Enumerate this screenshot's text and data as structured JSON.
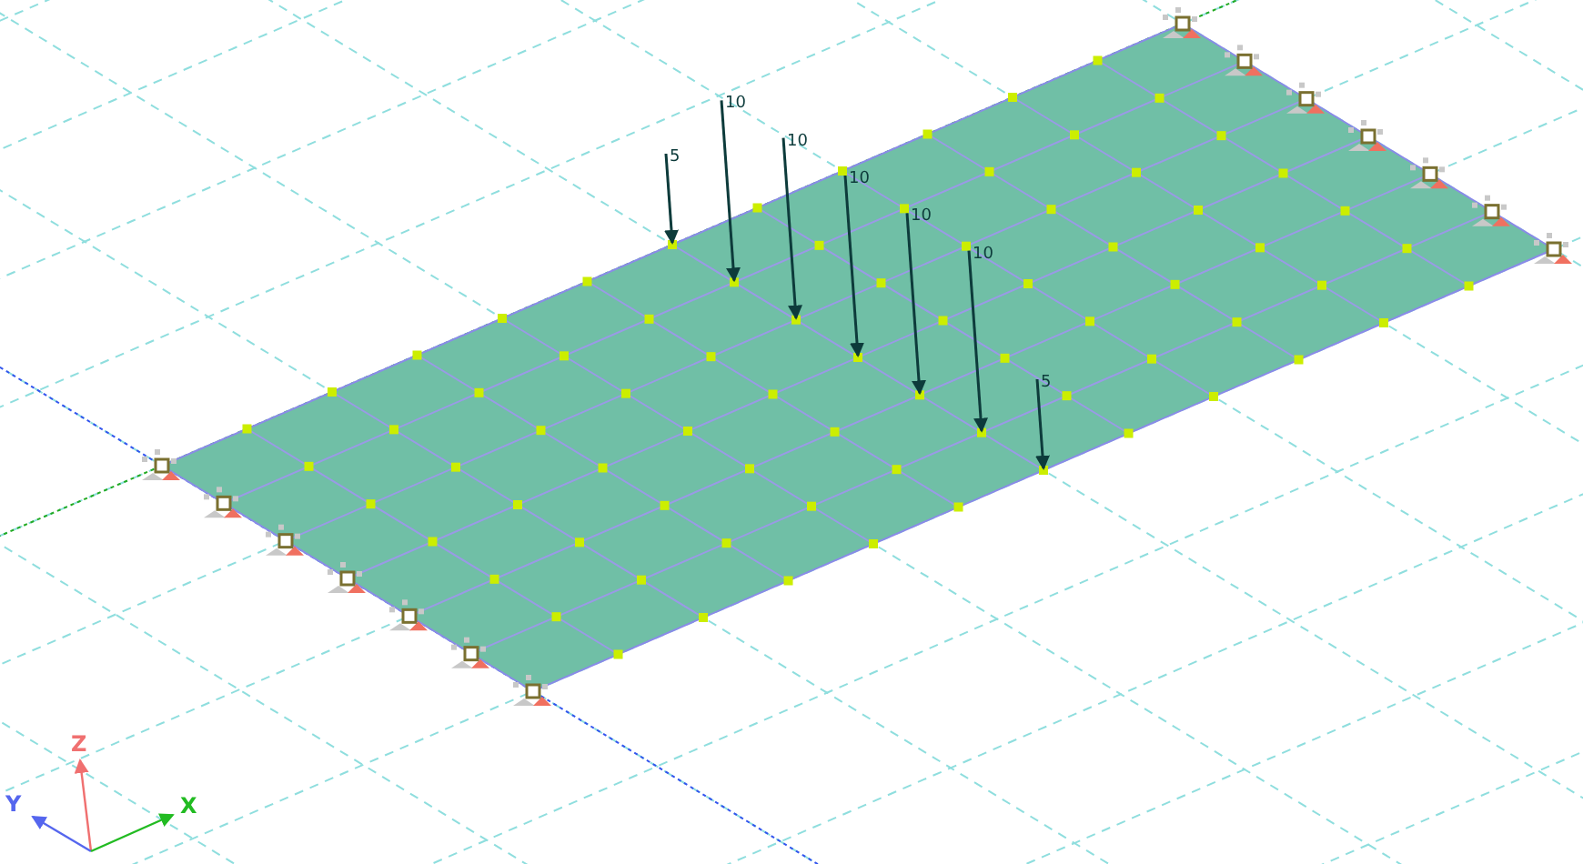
{
  "loads": [
    {
      "label": "5"
    },
    {
      "label": "10"
    },
    {
      "label": "10"
    },
    {
      "label": "10"
    },
    {
      "label": "10"
    },
    {
      "label": "10"
    },
    {
      "label": "5"
    }
  ],
  "axes": {
    "x": "X",
    "y": "Y",
    "z": "Z"
  }
}
